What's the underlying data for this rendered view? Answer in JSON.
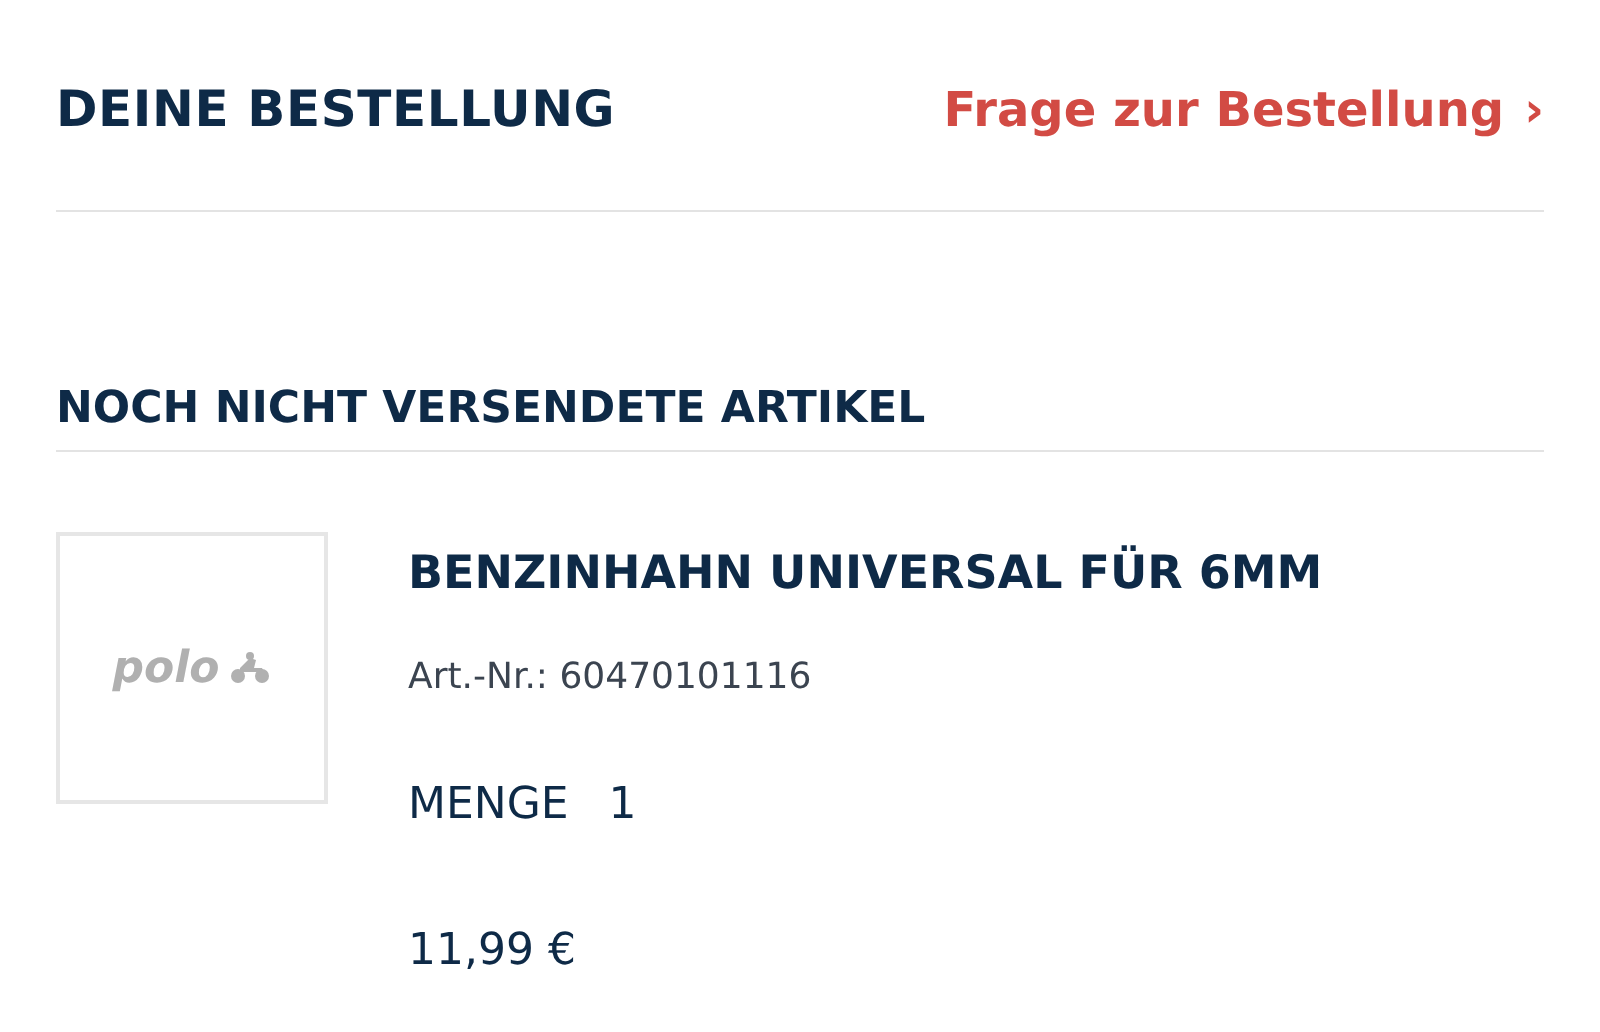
{
  "header": {
    "title": "DEINE BESTELLUNG",
    "link": "Frage zur Bestellung",
    "link_icon": "›"
  },
  "section": {
    "title": "NOCH NICHT VERSENDETE ARTIKEL"
  },
  "items": [
    {
      "image_logo": "polo",
      "name": "BENZINHAHN UNIVERSAL FÜR 6MM",
      "article_no": "Art.-Nr.: 60470101116",
      "quantity_label": "MENGE",
      "quantity": "1",
      "price": "11,99 €"
    }
  ]
}
